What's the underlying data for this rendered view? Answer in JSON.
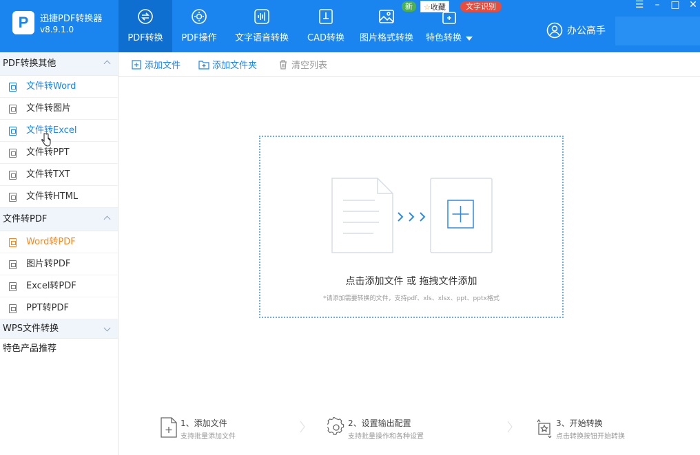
{
  "app": {
    "name": "迅捷PDF转换器",
    "version": "v8.9.1.0"
  },
  "nav": [
    {
      "label": "PDF转换",
      "icon": "convert-icon"
    },
    {
      "label": "PDF操作",
      "icon": "gear-icon"
    },
    {
      "label": "文字语音转换",
      "icon": "audio-wave-icon"
    },
    {
      "label": "CAD转换",
      "icon": "cad-icon"
    },
    {
      "label": "图片格式转换",
      "icon": "image-icon"
    },
    {
      "label": "特色转换",
      "icon": "special-icon"
    }
  ],
  "badges": {
    "new": "新",
    "favorite": "收藏",
    "ocr": "文字识别"
  },
  "user": {
    "label": "办公高手"
  },
  "window_controls": {
    "menu": "☰",
    "minimize": "–",
    "maximize": "□",
    "close": "✕"
  },
  "sidebar": {
    "groups": [
      {
        "title": "PDF转换其他",
        "items": [
          "文件转Word",
          "文件转图片",
          "文件转Excel",
          "文件转PPT",
          "文件转TXT",
          "文件转HTML"
        ]
      },
      {
        "title": "文件转PDF",
        "items": [
          "Word转PDF",
          "图片转PDF",
          "Excel转PDF",
          "PPT转PDF"
        ]
      },
      {
        "title": "WPS文件转换",
        "items": []
      }
    ],
    "featured": "特色产品推荐"
  },
  "toolbar": {
    "add_file": "添加文件",
    "add_folder": "添加文件夹",
    "clear_list": "清空列表"
  },
  "dropzone": {
    "title": "点击添加文件 或 拖拽文件添加",
    "hint": "*请添加需要转换的文件，支持pdf、xls、xlsx、ppt、pptx格式"
  },
  "steps": [
    {
      "title": "1、添加文件",
      "desc": "支持批量添加文件",
      "icon": "add-file-icon"
    },
    {
      "title": "2、设置输出配置",
      "desc": "支持批量操作和各种设置",
      "icon": "settings-icon"
    },
    {
      "title": "3、开始转换",
      "desc": "点击转换按钮开始转换",
      "icon": "start-convert-icon"
    }
  ],
  "colors": {
    "primary": "#1a85ee",
    "nav_active": "#0f6fd1",
    "highlight_orange": "#f08a24",
    "badge_green": "#4caf50",
    "badge_red": "#e84c3d"
  }
}
